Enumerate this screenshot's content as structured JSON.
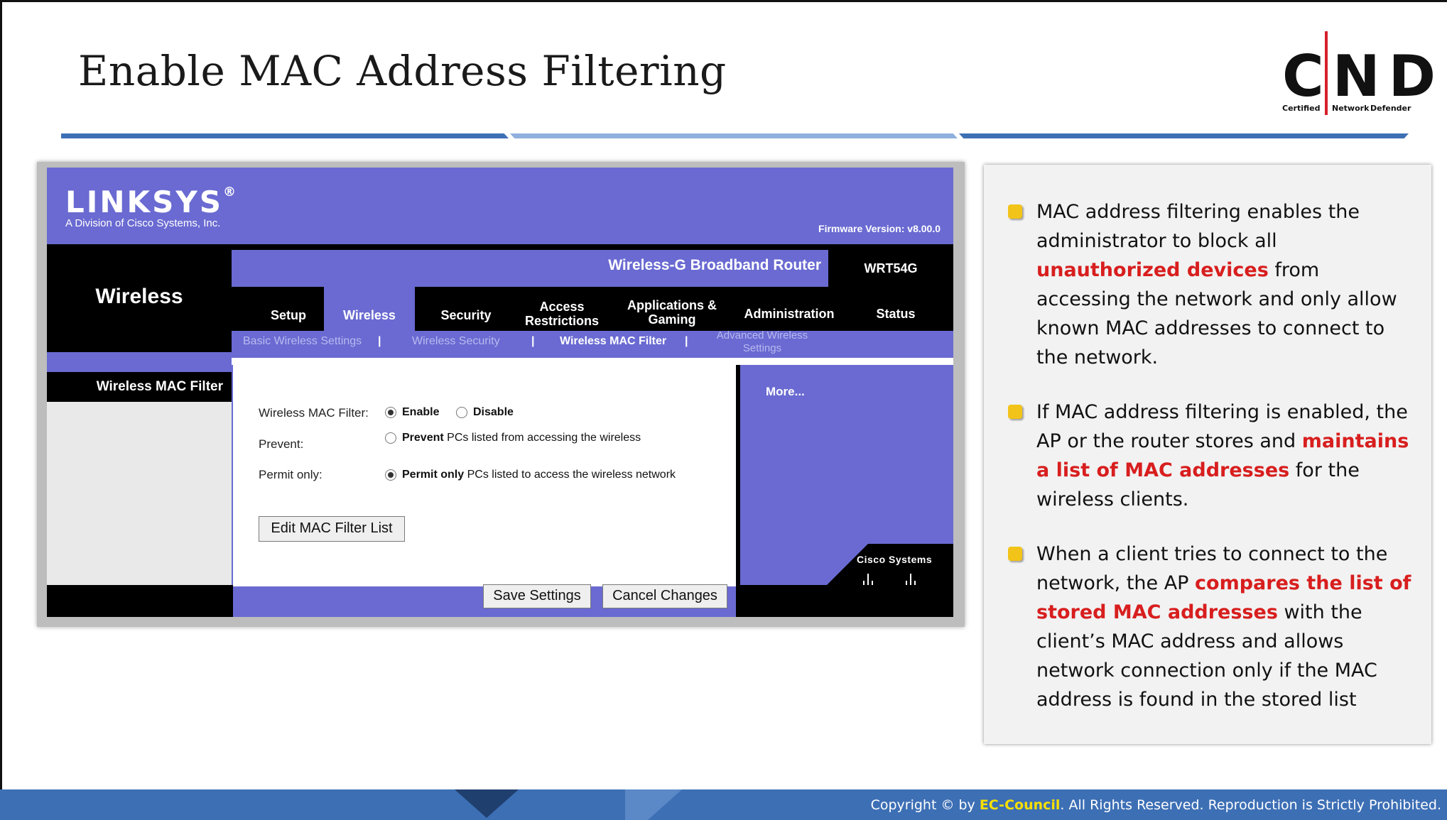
{
  "slide": {
    "title": "Enable MAC Address Filtering",
    "logo": {
      "letters": "CND",
      "sub_left": "Certified",
      "sub_mid": "Network",
      "sub_right": "Defender"
    }
  },
  "router": {
    "brand": "LINKSYS",
    "brand_mark": "®",
    "brand_sub": "A Division of Cisco Systems, Inc.",
    "firmware": "Firmware Version: v8.00.0",
    "product_name": "Wireless-G Broadband Router",
    "model": "WRT54G",
    "section_title": "Wireless",
    "tabs": [
      {
        "label": "Setup"
      },
      {
        "label": "Wireless"
      },
      {
        "label": "Security"
      },
      {
        "label": "Access Restrictions"
      },
      {
        "label": "Applications & Gaming"
      },
      {
        "label": "Administration"
      },
      {
        "label": "Status"
      }
    ],
    "subtabs": [
      {
        "label": "Basic Wireless Settings"
      },
      {
        "label": "Wireless Security"
      },
      {
        "label": "Wireless MAC Filter"
      },
      {
        "label": "Advanced Wireless Settings"
      }
    ],
    "left_label": "Wireless MAC Filter",
    "more_link": "More...",
    "form": {
      "filter_label": "Wireless MAC Filter:",
      "enable_label": "Enable",
      "disable_label": "Disable",
      "filter_value": "Enable",
      "prevent_label": "Prevent:",
      "prevent_option_bold": "Prevent",
      "prevent_option_rest": " PCs listed from accessing the wireless",
      "permit_label": "Permit only:",
      "permit_option_bold": "Permit only",
      "permit_option_rest": " PCs listed to access the wireless network",
      "access_value": "Permit only",
      "edit_button": "Edit MAC Filter List"
    },
    "save_button": "Save Settings",
    "cancel_button": "Cancel Changes",
    "cisco_label": "Cisco Systems"
  },
  "bullets": [
    {
      "before": "MAC address filtering enables the administrator to block all ",
      "highlight": "unauthorized devices",
      "after": " from accessing the network and only allow known MAC addresses to connect to the network."
    },
    {
      "before": "If MAC address filtering is enabled, the AP or the router stores and ",
      "highlight": "maintains a list of MAC addresses",
      "after": " for the wireless clients."
    },
    {
      "before": "When a client tries to connect to the network, the AP ",
      "highlight": "compares the list of stored MAC addresses",
      "after": " with the client’s MAC address and allows network connection only if the MAC address is found in the stored list"
    }
  ],
  "footer": {
    "copy_before": "Copyright © by ",
    "brand": "EC-Council",
    "copy_after": ". All Rights Reserved. Reproduction is Strictly Prohibited."
  },
  "colors": {
    "linksys_purple": "#6a6ad2",
    "accent_blue": "#3d6fb5",
    "highlight_red": "#d81e1e",
    "bullet_yellow": "#f2c318"
  }
}
